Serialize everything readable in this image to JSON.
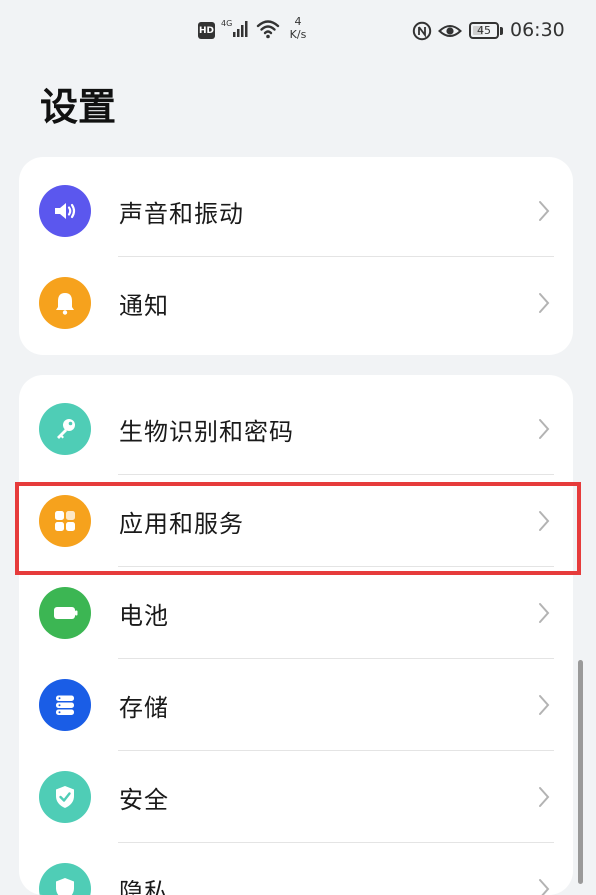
{
  "status_bar": {
    "hd": "HD",
    "network": "4G",
    "speed_value": "4",
    "speed_unit": "K/s",
    "battery": "45",
    "time": "06:30"
  },
  "page": {
    "title": "设置"
  },
  "groups": [
    {
      "items": [
        {
          "label": "声音和振动",
          "icon": "speaker-icon",
          "color": "#5b57ee"
        },
        {
          "label": "通知",
          "icon": "bell-icon",
          "color": "#f6a21d"
        }
      ]
    },
    {
      "items": [
        {
          "label": "生物识别和密码",
          "icon": "key-icon",
          "color": "#4fcdb6"
        },
        {
          "label": "应用和服务",
          "icon": "apps-grid-icon",
          "color": "#f6a21d",
          "highlighted": true
        },
        {
          "label": "电池",
          "icon": "battery-icon",
          "color": "#3cb653"
        },
        {
          "label": "存储",
          "icon": "storage-icon",
          "color": "#1a5de6"
        },
        {
          "label": "安全",
          "icon": "shield-icon",
          "color": "#4fcdb6"
        },
        {
          "label": "隐私",
          "icon": "privacy-icon",
          "color": "#4fcdb6"
        }
      ]
    }
  ],
  "highlight_color": "#e63b3b"
}
